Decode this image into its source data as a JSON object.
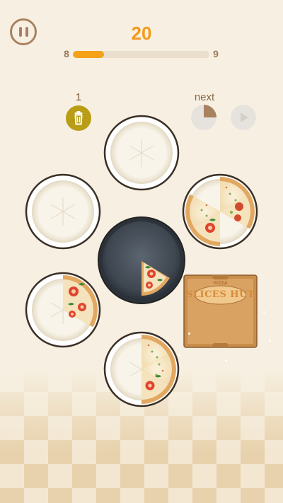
{
  "hud": {
    "score": "20",
    "level_current": "8",
    "level_next": "9",
    "level_progress": 0.23,
    "trash_count": "1",
    "next_label": "next",
    "next_slice_fraction": 0.25
  },
  "box": {
    "kicker": "PIZZA",
    "brand": "SLICES HUT"
  },
  "plates": [
    {
      "name": "top",
      "pizza_slices": 0
    },
    {
      "name": "upper-left",
      "pizza_slices": 0
    },
    {
      "name": "upper-right",
      "pizza_slices": 4
    },
    {
      "name": "center-pan",
      "pizza_slices": 1
    },
    {
      "name": "lower-left",
      "pizza_slices": 2
    },
    {
      "name": "bottom",
      "pizza_slices": 3
    }
  ],
  "colors": {
    "accent": "#f39a1c",
    "brown": "#a88260",
    "trash": "#b99d17"
  },
  "icons": [
    "pause-icon",
    "trash-icon",
    "play-icon",
    "pizza-box-icon"
  ]
}
